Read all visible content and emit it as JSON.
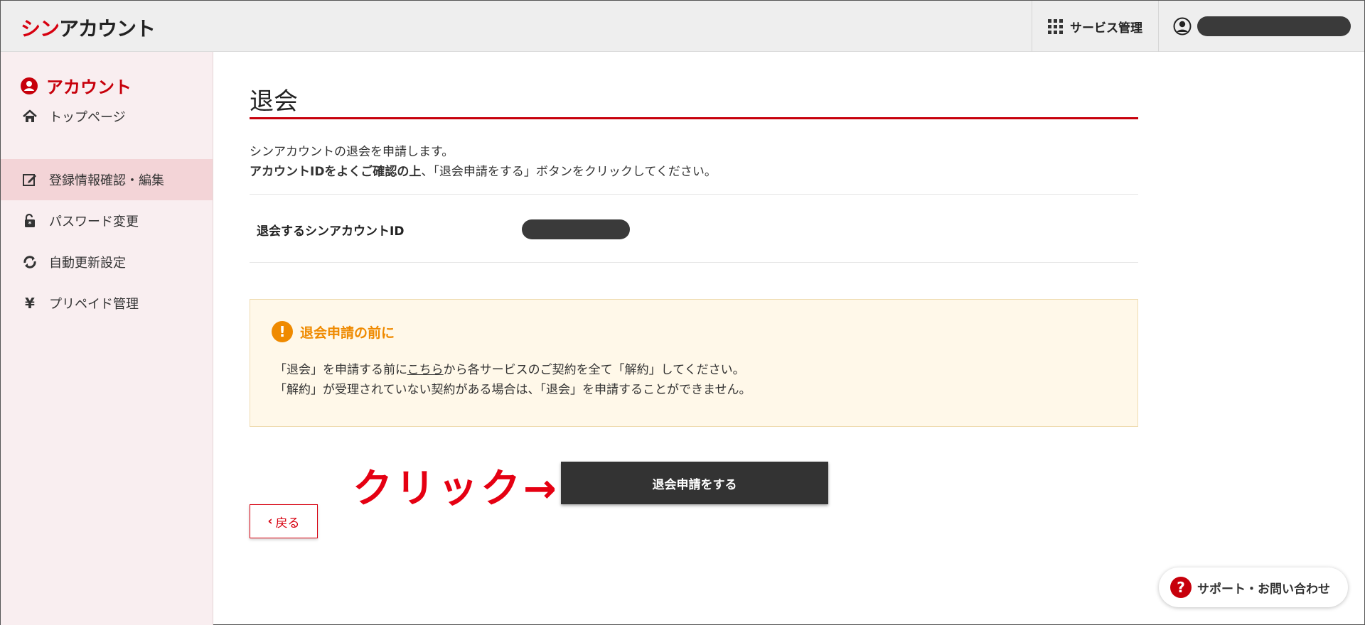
{
  "header": {
    "logo_red": "シン",
    "logo_black": "アカウント",
    "services_label": "サービス管理"
  },
  "sidebar": {
    "title": "アカウント",
    "items": [
      {
        "label": "トップページ",
        "icon": "home-icon"
      },
      {
        "label": "登録情報確認・編集",
        "icon": "edit-icon",
        "active": true
      },
      {
        "label": "パスワード変更",
        "icon": "lock-icon"
      },
      {
        "label": "自動更新設定",
        "icon": "refresh-icon"
      },
      {
        "label": "プリペイド管理",
        "icon": "yen-icon"
      }
    ]
  },
  "main": {
    "title": "退会",
    "desc_line1": "シンアカウントの退会を申請します。",
    "desc_line2_bold": "アカウントIDをよくご確認の上",
    "desc_line2_rest": "、「退会申請をする」ボタンをクリックしてください。",
    "account_id_label": "退会するシンアカウントID",
    "notice": {
      "title": "退会申請の前に",
      "line1_pre": "「退会」を申請する前に",
      "line1_link": "こちら",
      "line1_post": "から各サービスのご契約を全て「解約」してください。",
      "line2": "「解約」が受理されていない契約がある場合は、「退会」を申請することができません。"
    },
    "annotation": "クリック→",
    "withdraw_button": "退会申請をする",
    "back_button": "戻る"
  },
  "support": {
    "label": "サポート・お問い合わせ"
  },
  "colors": {
    "brand_red": "#c7000b",
    "warning_orange": "#ef8a00",
    "sidebar_bg": "#f9eef0",
    "sidebar_active": "#f3d4d7",
    "button_dark": "#333333"
  }
}
